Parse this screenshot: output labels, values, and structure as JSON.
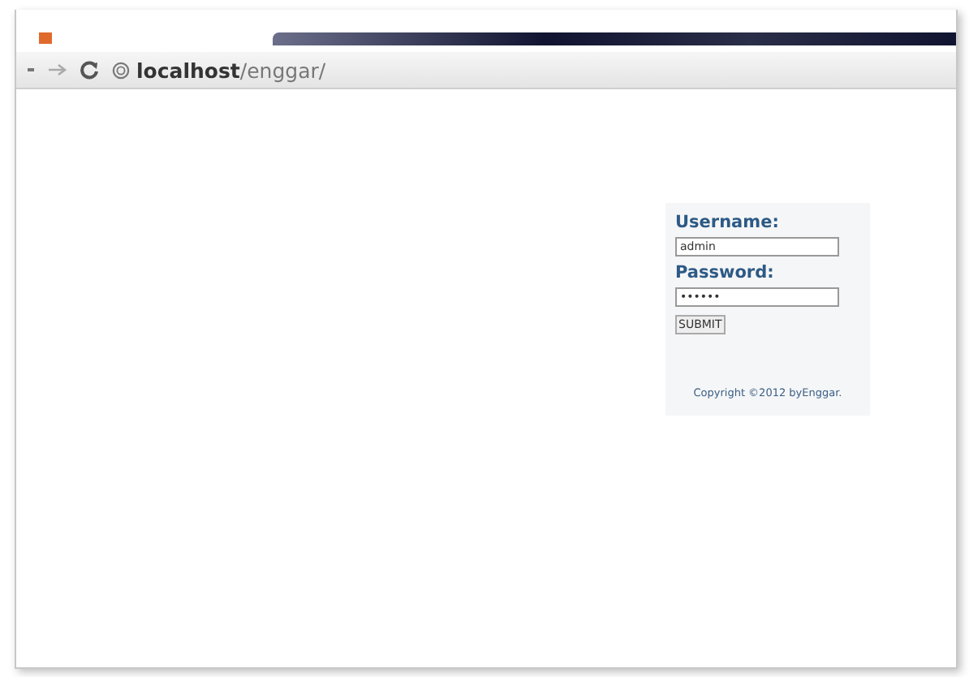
{
  "browser": {
    "address_host": "localhost",
    "address_path": "/enggar/"
  },
  "login": {
    "username_label": "Username:",
    "username_value": "admin",
    "password_label": "Password:",
    "password_value": "••••••",
    "submit": "SUBMIT",
    "copyright": "Copyright ©2012 byEnggar."
  }
}
